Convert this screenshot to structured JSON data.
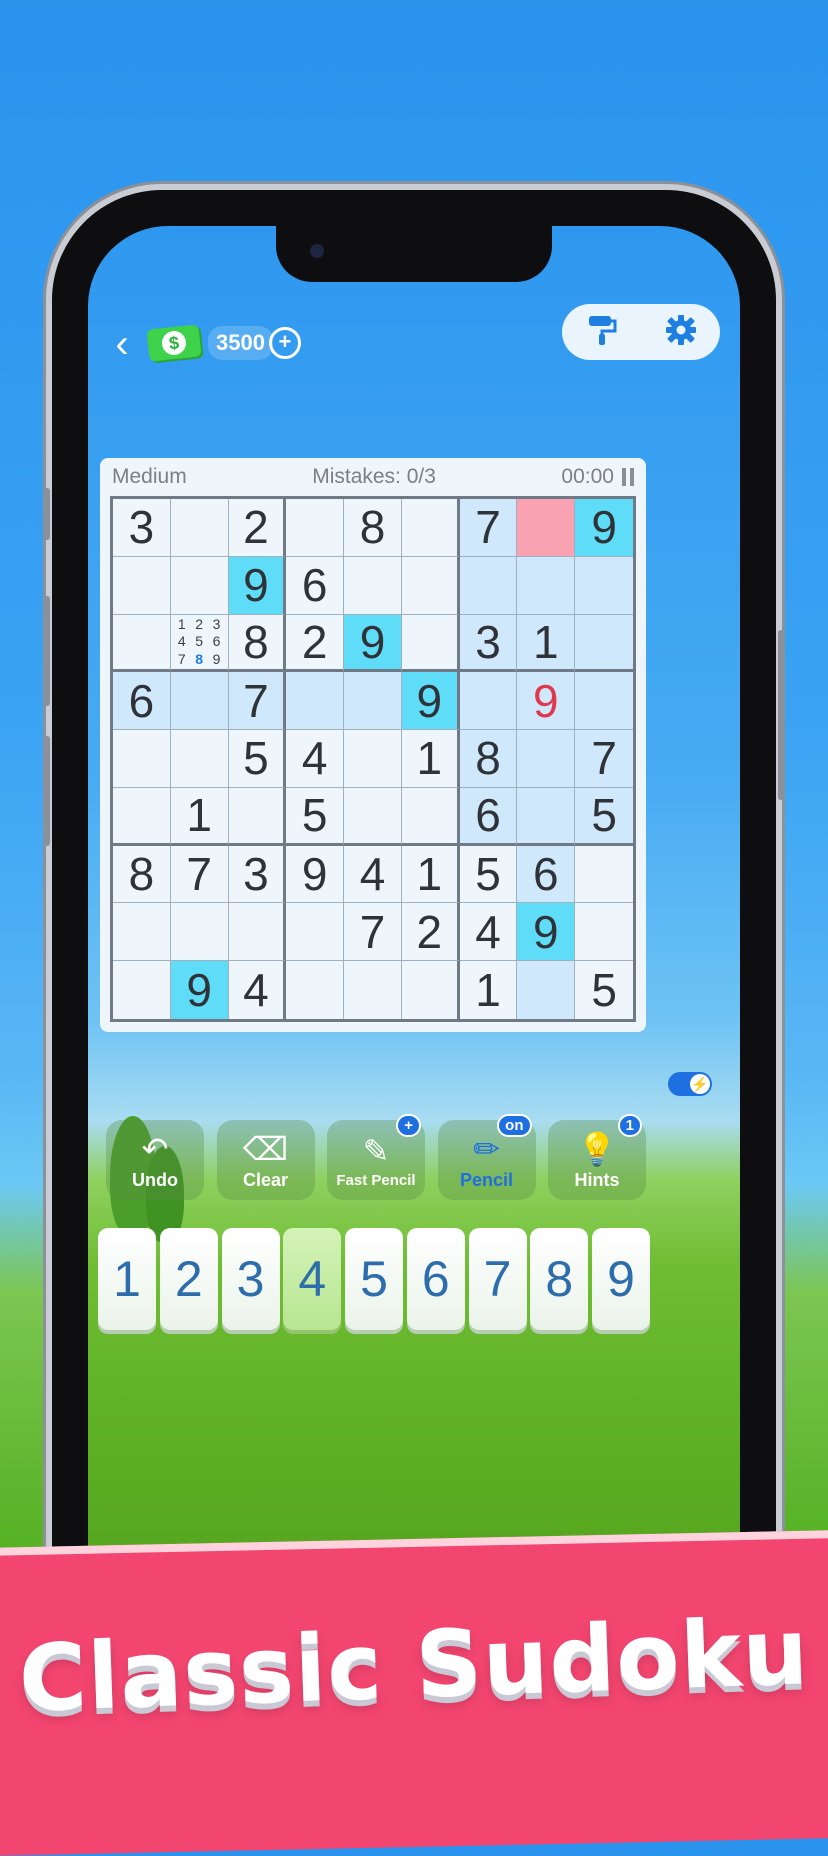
{
  "header": {
    "back_icon": "chevron-left-icon",
    "coins": "3500",
    "coin_icon": "cash-icon",
    "add_icon": "plus-circle-icon",
    "theme_icon": "paint-roller-icon",
    "settings_icon": "gear-icon"
  },
  "game": {
    "difficulty": "Medium",
    "mistakes": "Mistakes: 0/3",
    "timer": "00:00"
  },
  "board": {
    "cells": [
      [
        "3",
        "",
        "2",
        "",
        "8",
        "",
        "7",
        "",
        "9"
      ],
      [
        "",
        "",
        "9",
        "6",
        "",
        "",
        "",
        "",
        ""
      ],
      [
        "",
        "",
        "8",
        "2",
        "9",
        "",
        "3",
        "1",
        ""
      ],
      [
        "6",
        "",
        "7",
        "",
        "",
        "9",
        "",
        "9",
        ""
      ],
      [
        "",
        "",
        "5",
        "4",
        "",
        "1",
        "8",
        "",
        "7"
      ],
      [
        "",
        "1",
        "",
        "5",
        "",
        "",
        "6",
        "",
        "5"
      ],
      [
        "8",
        "7",
        "3",
        "9",
        "4",
        "1",
        "5",
        "6",
        ""
      ],
      [
        "",
        "",
        "",
        "",
        "7",
        "2",
        "4",
        "9",
        ""
      ],
      [
        "",
        "9",
        "4",
        "",
        "",
        "",
        "1",
        "",
        "5"
      ]
    ],
    "notes_cell_values": [
      "1",
      "2",
      "3",
      "4",
      "5",
      "6",
      "7",
      "8",
      "9"
    ],
    "notes_highlight": "8"
  },
  "actions": {
    "undo": "Undo",
    "clear": "Clear",
    "fast_pencil": "Fast Pencil",
    "pencil": "Pencil",
    "pencil_badge": "on",
    "hints": "Hints",
    "hints_badge": "1",
    "fast_pencil_badge": "+"
  },
  "numpad": [
    "1",
    "2",
    "3",
    "4",
    "5",
    "6",
    "7",
    "8",
    "9"
  ],
  "banner": {
    "title": "Classic Sudoku"
  },
  "colors": {
    "accent": "#1e6fe0",
    "banner": "#f2456f",
    "same_number": "#5fdcf7",
    "selected": "#f8a2b2",
    "error": "#e0394e"
  }
}
